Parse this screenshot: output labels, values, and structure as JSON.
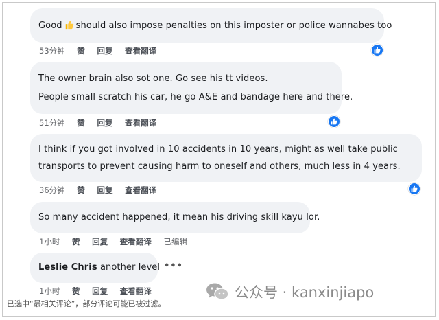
{
  "comments": [
    {
      "lines": [
        "Good",
        "should also impose penalties on this imposter or police wannabes too"
      ],
      "emoji_icon": "thumbs-up-emoji",
      "time": "53分钟",
      "like": "赞",
      "reply": "回复",
      "translate": "查看翻译",
      "edited": ""
    },
    {
      "lines": [
        "The owner brain also sot one. Go see his tt videos.",
        "People small scratch his car, he go A&E and bandage here and there."
      ],
      "time": "51分钟",
      "like": "赞",
      "reply": "回复",
      "translate": "查看翻译",
      "edited": ""
    },
    {
      "lines": [
        "I think if you got involved in 10 accidents in 10 years, might as well take public",
        "transports to prevent causing harm to oneself and others, much less in 4 years."
      ],
      "time": "36分钟",
      "like": "赞",
      "reply": "回复",
      "translate": "查看翻译",
      "edited": ""
    },
    {
      "lines": [
        "So many accident happened, it mean his driving skill kayu lor."
      ],
      "time": "1小时",
      "like": "赞",
      "reply": "回复",
      "translate": "查看翻译",
      "edited": "已编辑"
    },
    {
      "author": "Leslie Chris",
      "lines": [
        "another level"
      ],
      "time": "1小时",
      "like": "赞",
      "reply": "回复",
      "translate": "查看翻译",
      "edited": ""
    }
  ],
  "more_icon": "more-dots-icon",
  "like_badge_icon": "like-reaction-icon",
  "footnote": "已选中“最相关评论”，部分评论可能已被过滤。",
  "watermark": {
    "text": "公众号 · kanxinjiapo",
    "icon": "wechat-logo-icon"
  },
  "colors": {
    "bubble": "#f0f2f5",
    "like_blue": "#1877f2",
    "meta": "#65676b"
  }
}
